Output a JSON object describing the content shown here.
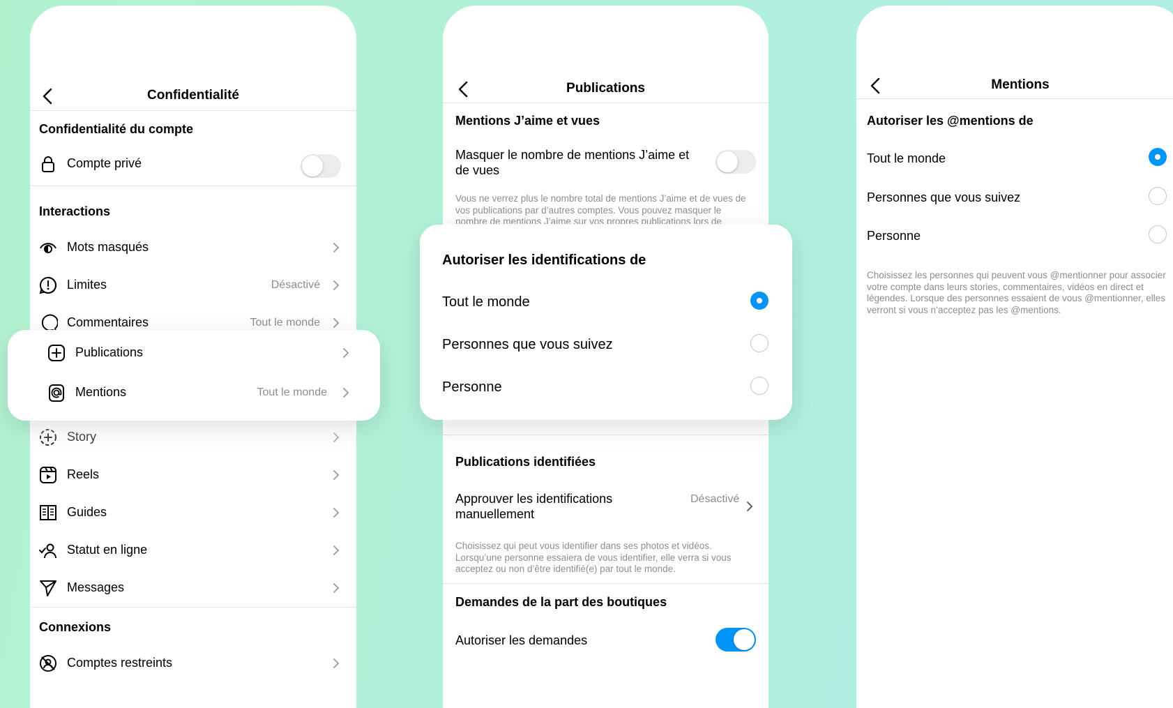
{
  "screens": {
    "privacy": {
      "title": "Confidentialité",
      "account_section": "Confidentialité du compte",
      "private_account": {
        "label": "Compte privé",
        "enabled": false
      },
      "interactions_section": "Interactions",
      "items": [
        {
          "label": "Mots masqués",
          "value": "",
          "icon": "hidden-words-icon"
        },
        {
          "label": "Limites",
          "value": "Désactivé",
          "icon": "limits-icon"
        },
        {
          "label": "Commentaires",
          "value": "Tout le monde",
          "icon": "comment-icon"
        }
      ],
      "highlight": [
        {
          "label": "Publications",
          "value": "",
          "icon": "plus-square-icon"
        },
        {
          "label": "Mentions",
          "value": "Tout le monde",
          "icon": "at-sign-icon"
        }
      ],
      "items2": [
        {
          "label": "Story",
          "value": "",
          "icon": "story-icon"
        },
        {
          "label": "Reels",
          "value": "",
          "icon": "reels-icon"
        },
        {
          "label": "Guides",
          "value": "",
          "icon": "guides-icon"
        },
        {
          "label": "Statut en ligne",
          "value": "",
          "icon": "online-status-icon"
        },
        {
          "label": "Messages",
          "value": "",
          "icon": "messages-icon"
        }
      ],
      "connections_section": "Connexions",
      "restricted": {
        "label": "Comptes restreints",
        "icon": "restricted-accounts-icon"
      }
    },
    "posts": {
      "title": "Publications",
      "likes_section": "Mentions J’aime et vues",
      "hide_likes": {
        "label": "Masquer le nombre de mentions J’aime et de vues",
        "enabled": false
      },
      "hide_likes_note": "Vous ne verrez plus le nombre total de mentions J’aime et de vues de vos publications par d’autres comptes. Vous pouvez masquer le nombre de mentions J’aime sur vos propres publications lors de",
      "tags_card": {
        "title": "Autoriser les identifications de",
        "options": [
          "Tout le monde",
          "Personnes que vous suivez",
          "Personne"
        ],
        "selected_index": 0
      },
      "tagged_section": "Publications identifiées",
      "manual_approve": {
        "label": "Approuver les identifications manuellement",
        "value": "Désactivé"
      },
      "tags_note": "Choisissez qui peut vous identifier dans ses photos et vidéos. Lorsqu’une personne essaiera de vous identifier, elle verra si vous acceptez ou non d’être identifié(e) par tout le monde.",
      "shops_section": "Demandes de la part des boutiques",
      "allow_requests": {
        "label": "Autoriser les demandes",
        "enabled": true
      }
    },
    "mentions": {
      "title": "Mentions",
      "section": "Autoriser les @mentions de",
      "options": [
        "Tout le monde",
        "Personnes que vous suivez",
        "Personne"
      ],
      "selected_index": 0,
      "note": "Choisissez les personnes qui peuvent vous @mentionner pour associer votre compte dans leurs stories, commentaires, vidéos en direct et légendes. Lorsque des personnes essaient de vous @mentionner, elles verront si vous n’acceptez pas les @mentions."
    }
  },
  "colors": {
    "accent": "#0095f6",
    "secondary_text": "#8e8e8e",
    "toggle_off": "#ececec"
  }
}
